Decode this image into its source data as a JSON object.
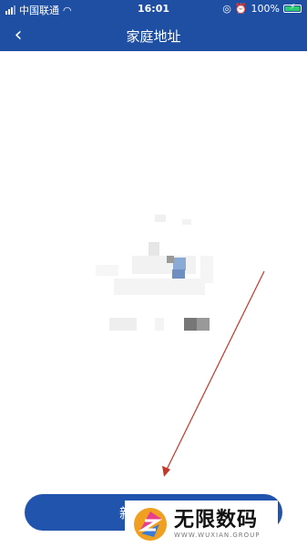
{
  "status_bar": {
    "carrier": "中国联通",
    "time": "16:01",
    "battery": "100%"
  },
  "nav": {
    "title": "家庭地址",
    "back_icon": "chevron-left-icon"
  },
  "footer": {
    "add_button_label": "新"
  },
  "watermark": {
    "cn": "无限数码",
    "en": "WWW.WUXIAN.GROUP"
  },
  "colors": {
    "header": "#1f4fa3",
    "button": "#2154ad",
    "annotation_arrow": "#c0392b"
  }
}
